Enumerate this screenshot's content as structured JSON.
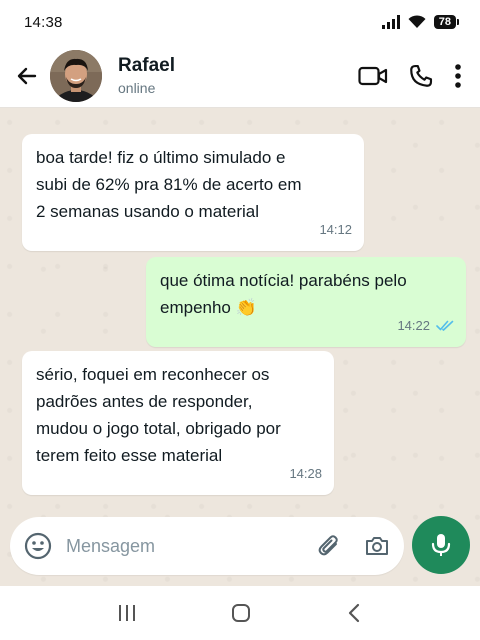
{
  "status_bar": {
    "time": "14:38",
    "battery": "78"
  },
  "header": {
    "name": "Rafael",
    "status": "online"
  },
  "messages": [
    {
      "direction": "in",
      "text": "boa tarde! fiz o último simulado e\nsubi de 62% pra 81% de acerto em\n2 semanas usando o material",
      "time": "14:12"
    },
    {
      "direction": "out",
      "text": "que ótima notícia! parabéns pelo\nempenho 👏",
      "time": "14:22",
      "status": "read"
    },
    {
      "direction": "in",
      "text": "sério, foquei em reconhecer os\npadrões antes de responder,\nmudou o jogo total, obrigado por\nterem feito esse material",
      "time": "14:28"
    }
  ],
  "composer": {
    "placeholder": "Mensagem"
  },
  "colors": {
    "accent": "#1f8a5b",
    "outgoing_bubble": "#d9fdd3",
    "chat_bg": "#ede6dd",
    "read_ticks": "#53bdeb"
  }
}
